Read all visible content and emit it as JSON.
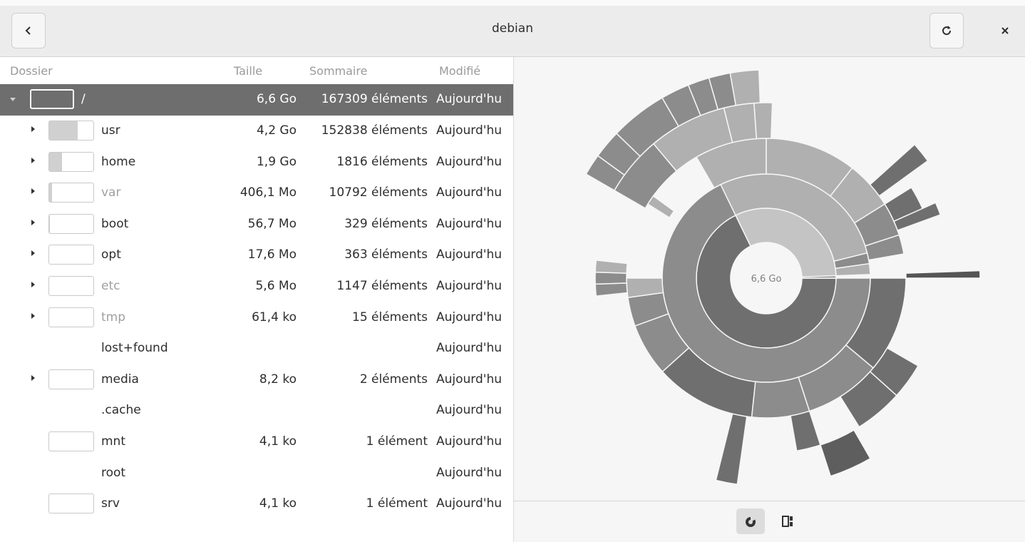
{
  "header": {
    "title": "debian"
  },
  "columns": {
    "folder": "Dossier",
    "size": "Taille",
    "contents": "Sommaire",
    "modified": "Modifié"
  },
  "root": {
    "name": "/",
    "size": "6,6 Go",
    "contents": "167309 éléments",
    "modified": "Aujourd'hu"
  },
  "rows": [
    {
      "name": "usr",
      "size": "4,2 Go",
      "contents": "152838 éléments",
      "modified": "Aujourd'hu",
      "usage_fraction": 0.64
    },
    {
      "name": "home",
      "size": "1,9 Go",
      "contents": "1816 éléments",
      "modified": "Aujourd'hu",
      "usage_fraction": 0.29
    },
    {
      "name": "var",
      "size": "406,1 Mo",
      "contents": "10792 éléments",
      "modified": "Aujourd'hu",
      "usage_fraction": 0.06
    },
    {
      "name": "boot",
      "size": "56,7 Mo",
      "contents": "329 éléments",
      "modified": "Aujourd'hu",
      "usage_fraction": 0.01
    },
    {
      "name": "opt",
      "size": "17,6 Mo",
      "contents": "363 éléments",
      "modified": "Aujourd'hu",
      "usage_fraction": 0.0
    },
    {
      "name": "etc",
      "size": "5,6 Mo",
      "contents": "1147 éléments",
      "modified": "Aujourd'hu",
      "usage_fraction": 0.0
    },
    {
      "name": "tmp",
      "size": "61,4 ko",
      "contents": "15 éléments",
      "modified": "Aujourd'hu",
      "usage_fraction": 0.0
    },
    {
      "name": "lost+found",
      "size": "",
      "contents": "",
      "modified": "Aujourd'hu",
      "usage_fraction": null
    },
    {
      "name": "media",
      "size": "8,2 ko",
      "contents": "2 éléments",
      "modified": "Aujourd'hu",
      "usage_fraction": 0.0
    },
    {
      "name": ".cache",
      "size": "",
      "contents": "",
      "modified": "Aujourd'hu",
      "usage_fraction": null
    },
    {
      "name": "mnt",
      "size": "4,1 ko",
      "contents": "1 élément",
      "modified": "Aujourd'hu",
      "usage_fraction": 0.0
    },
    {
      "name": "root",
      "size": "",
      "contents": "",
      "modified": "Aujourd'hu",
      "usage_fraction": null
    },
    {
      "name": "srv",
      "size": "4,1 ko",
      "contents": "1 élément",
      "modified": "Aujourd'hu",
      "usage_fraction": 0.0
    }
  ],
  "chart": {
    "center_label": "6,6 Go"
  },
  "icons": {
    "back": "go-previous-icon",
    "reload": "view-refresh-icon",
    "close": "window-close-icon",
    "rings_mode": "rings-chart-icon",
    "treemap_mode": "treemap-chart-icon"
  }
}
